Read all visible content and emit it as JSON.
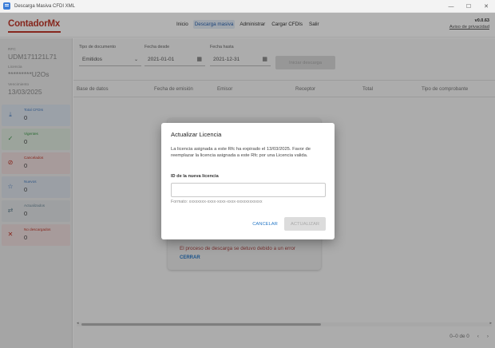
{
  "window": {
    "title": "Descarga Masiva CFDI XML",
    "minimize": "—",
    "maximize": "☐",
    "close": "✕"
  },
  "header": {
    "logo": "ContadorMx",
    "nav": [
      "Inicio",
      "Descarga masiva",
      "Administrar",
      "Cargar CFDIs",
      "Salir"
    ],
    "active_nav": "Descarga masiva",
    "version": "v0.0.63",
    "privacy": "Aviso de privacidad"
  },
  "sidebar": {
    "rfc_label": "RFC",
    "rfc_value": "UDM171121L71",
    "licencia_label": "Licencia",
    "licencia_value": "*********U2Os",
    "vencimiento_label": "Vencimiento",
    "vencimiento_value": "13/03/2025",
    "stats": [
      {
        "label": "Total CFDIs",
        "value": "0",
        "icon": "download-icon",
        "color": "#4a7fc1",
        "bg": "#dfe7f1"
      },
      {
        "label": "Vigentes",
        "value": "0",
        "icon": "check-icon",
        "color": "#3e9a4a",
        "bg": "#e0ebe0"
      },
      {
        "label": "Cancelados",
        "value": "0",
        "icon": "cancel-icon",
        "color": "#c0392b",
        "bg": "#f0dede"
      },
      {
        "label": "Nuevos",
        "value": "0",
        "icon": "star-icon",
        "color": "#4a7fc1",
        "bg": "#dfe4ec"
      },
      {
        "label": "Actualizados",
        "value": "0",
        "icon": "swap-icon",
        "color": "#6f8a9a",
        "bg": "#e2e6e8"
      },
      {
        "label": "No descargados",
        "value": "0",
        "icon": "x-icon",
        "color": "#c0392b",
        "bg": "#f0dede"
      }
    ]
  },
  "filters": {
    "tipo_label": "Tipo de documento",
    "tipo_value": "Emitidos",
    "desde_label": "Fecha desde",
    "desde_value": "2021-01-01",
    "hasta_label": "Fecha hasta",
    "hasta_value": "2021-12-31",
    "descargar": "Iniciar descarga"
  },
  "table": {
    "columns": [
      "Base de datos",
      "Fecha de emisión",
      "Emisor",
      "Receptor",
      "Total",
      "Tipo de comprobante"
    ],
    "error_text": "El proceso de descarga se detuvo debido a un error",
    "cerrar": "CERRAR",
    "pager": "0–0 de 0",
    "prev": "‹",
    "next": "›"
  },
  "dialog": {
    "title": "Actualizar Licencia",
    "message": "La licencia asignada a este Rfc ha expirado el 13/03/2025. Favor de reemplazar la licencia asignada a este Rfc por una Licencia valida.",
    "field_label": "ID de la nueva licencia",
    "field_value": "",
    "hint": "Formato: xxxxxxxx-xxxx-xxxx-xxxx-xxxxxxxxxxxx",
    "cancel": "CANCELAR",
    "update": "ACTUALIZAR"
  }
}
